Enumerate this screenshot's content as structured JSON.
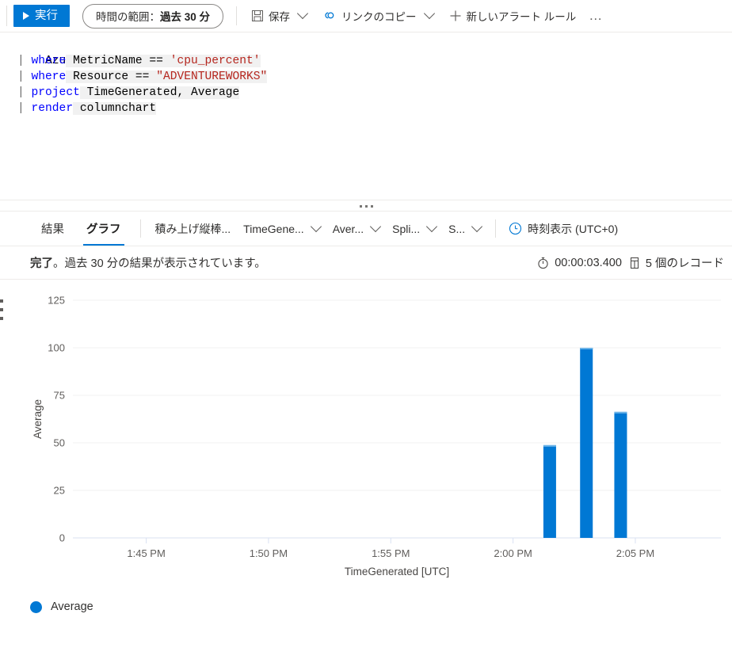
{
  "toolbar": {
    "run_label": "実行",
    "run_icon": "play-icon",
    "time_range_label": "時間の範囲：",
    "time_range_value": "過去 30 分",
    "save_label": "保存",
    "save_icon": "save-floppy-icon",
    "copy_link_label": "リンクのコピー",
    "copy_link_icon": "link-chain-icon",
    "new_alert_label": "新しいアラート ルール",
    "new_alert_icon": "plus-icon",
    "overflow_label": "…",
    "accent_color": "#0078d4"
  },
  "editor": {
    "lines": [
      {
        "pipe": "",
        "keyword": "",
        "rest": "AzureMetrics",
        "string": ""
      },
      {
        "pipe": "|",
        "keyword": "where",
        "rest": " MetricName == ",
        "string": "'cpu_percent'"
      },
      {
        "pipe": "|",
        "keyword": "where",
        "rest": " Resource == ",
        "string": "\"ADVENTUREWORKS\""
      },
      {
        "pipe": "|",
        "keyword": "project",
        "rest": " TimeGenerated, Average",
        "string": ""
      },
      {
        "pipe": "|",
        "keyword": "render",
        "rest": " columnchart",
        "string": ""
      }
    ]
  },
  "results": {
    "tabs": [
      {
        "label": "結果",
        "active": false
      },
      {
        "label": "グラフ",
        "active": true
      }
    ],
    "chart_controls": [
      {
        "label": "積み上げ縦棒...",
        "has_chevron": false
      },
      {
        "label": "TimeGene...",
        "has_chevron": true
      },
      {
        "label": "Aver...",
        "has_chevron": true
      },
      {
        "label": "Spli...",
        "has_chevron": true
      },
      {
        "label": "S...",
        "has_chevron": true
      }
    ],
    "time_display_label": "時刻表示 (UTC+0)",
    "time_display_icon": "clock-icon",
    "status_prefix": "完了",
    "status_message": "。過去 30 分の結果が表示されています。",
    "duration_icon": "timer-icon",
    "duration": "00:00:03.400",
    "records_icon": "records-icon",
    "records": "5 個のレコード"
  },
  "chart_data": {
    "type": "bar",
    "title": "",
    "xlabel": "TimeGenerated [UTC]",
    "ylabel": "Average",
    "ylim": [
      0,
      125
    ],
    "yticks": [
      0,
      25,
      50,
      75,
      100,
      125
    ],
    "xticks": [
      "1:45 PM",
      "1:50 PM",
      "1:55 PM",
      "2:00 PM",
      "2:05 PM"
    ],
    "xtick_minutes": [
      105,
      110,
      115,
      120,
      125
    ],
    "xlim_minutes": [
      102,
      128.5
    ],
    "grid": true,
    "legend_position": "bottom-left",
    "series": [
      {
        "name": "Average",
        "color": "#0078d4",
        "points": [
          {
            "x_label": "2:01 PM",
            "x_minutes": 121.5,
            "value": 48.8
          },
          {
            "x_label": "2:02 PM",
            "x_minutes": 123.0,
            "value": 100
          },
          {
            "x_label": "2:03 PM",
            "x_minutes": 124.4,
            "value": 66.3
          }
        ]
      }
    ],
    "legend": [
      {
        "label": "Average",
        "color": "#0078d4"
      }
    ]
  }
}
